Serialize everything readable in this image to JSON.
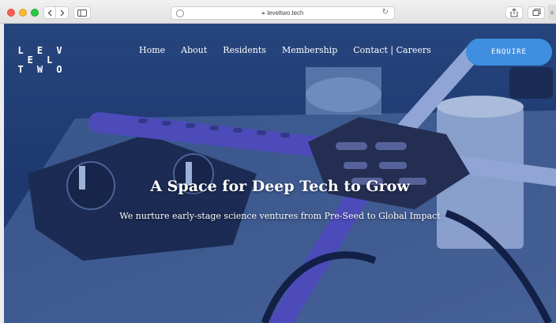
{
  "browser": {
    "url": "leveltwo.tech"
  },
  "site": {
    "logo_line1": "L E V E L",
    "logo_line2": "T W O",
    "nav": [
      {
        "label": "Home"
      },
      {
        "label": "About"
      },
      {
        "label": "Residents"
      },
      {
        "label": "Membership"
      },
      {
        "label": "Contact | Careers"
      }
    ],
    "enquire_label": "ENQUIRE"
  },
  "hero": {
    "title": "A Space for Deep Tech to Grow",
    "subtitle": "We nurture early-stage science ventures from Pre-Seed to Global Impact"
  },
  "colors": {
    "accent": "#3f8edf",
    "overlay": "#1c2f5a"
  }
}
